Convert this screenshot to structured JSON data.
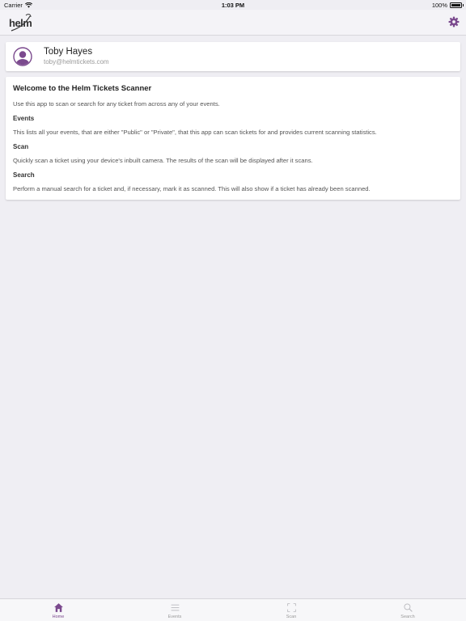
{
  "status": {
    "carrier": "Carrier",
    "time": "1:03 PM",
    "battery": "100%"
  },
  "nav": {
    "logo_text": "helm"
  },
  "user": {
    "name": "Toby Hayes",
    "email": "toby@helmtickets.com"
  },
  "info": {
    "title": "Welcome to the Helm Tickets Scanner",
    "intro": "Use this app to scan or search for any ticket from across any of your events.",
    "sections": [
      {
        "heading": "Events",
        "text": "This lists all your events, that are either \"Public\" or \"Private\", that this app can scan tickets for and provides current scanning statistics."
      },
      {
        "heading": "Scan",
        "text": "Quickly scan a ticket using your device's inbuilt camera. The results of the scan will be displayed after it scans."
      },
      {
        "heading": "Search",
        "text": "Perform a manual search for a ticket and, if necessary, mark it as scanned. This will also show if a ticket has already been scanned."
      }
    ]
  },
  "tabs": [
    {
      "label": "Home",
      "icon": "home-icon",
      "active": true
    },
    {
      "label": "Events",
      "icon": "list-icon",
      "active": false
    },
    {
      "label": "Scan",
      "icon": "scan-frame-icon",
      "active": false
    },
    {
      "label": "Search",
      "icon": "search-icon",
      "active": false
    }
  ],
  "colors": {
    "accent": "#7b4a8e",
    "background": "#efeef3",
    "inactive_icon": "#b8b8bd"
  }
}
